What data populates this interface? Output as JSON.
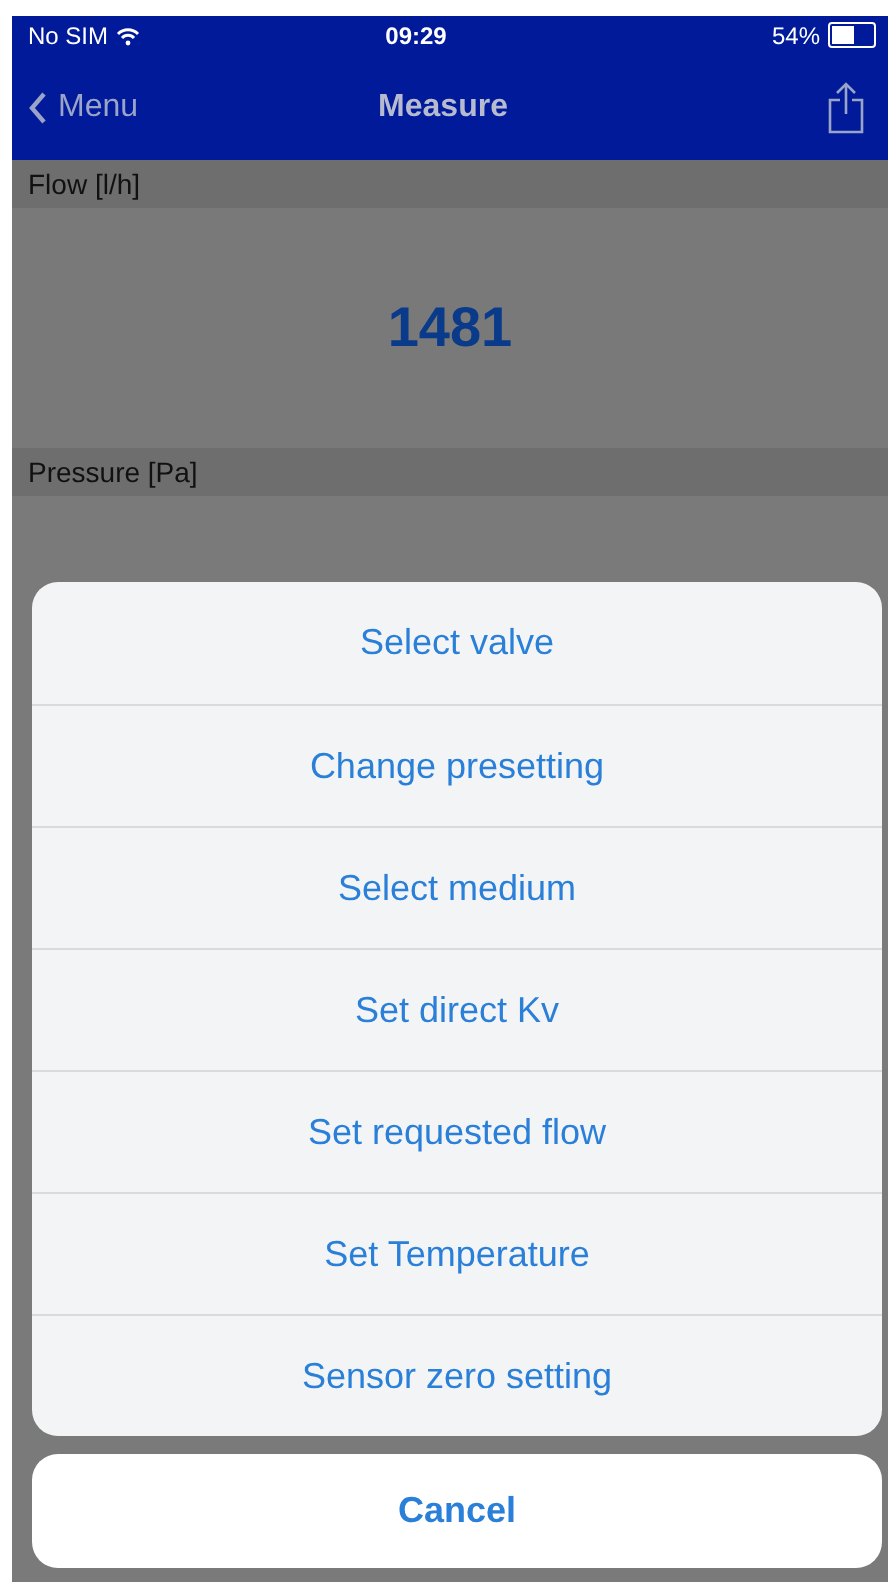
{
  "status_bar": {
    "carrier": "No SIM",
    "time": "09:29",
    "battery": {
      "text": "54%",
      "level": 0.54
    }
  },
  "nav": {
    "back": "Menu",
    "title": "Measure"
  },
  "sections": [
    {
      "label": "Flow [l/h]",
      "value": "1481"
    },
    {
      "label": "Pressure [Pa]"
    }
  ],
  "action_sheet": {
    "actions": [
      "Select valve",
      "Change presetting",
      "Select medium",
      "Set direct Kv",
      "Set requested flow",
      "Set Temperature",
      "Sensor zero setting"
    ],
    "cancel": "Cancel"
  }
}
